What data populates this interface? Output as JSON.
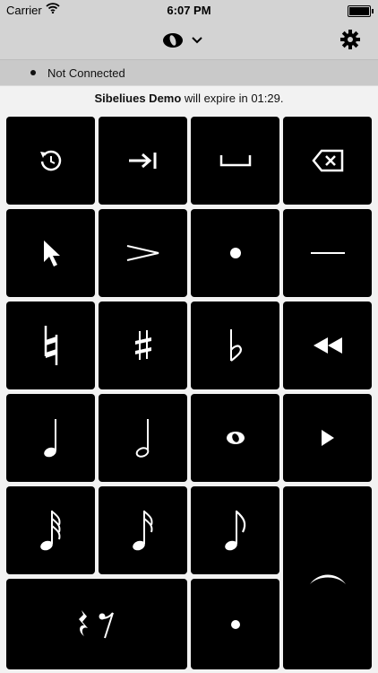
{
  "status_bar": {
    "carrier": "Carrier",
    "time": "6:07 PM"
  },
  "nav": {
    "logo_icon": "sibelius-logo-icon",
    "dropdown_icon": "chevron-down-icon",
    "settings_icon": "gear-icon"
  },
  "connection": {
    "status": "Not Connected"
  },
  "notice": {
    "app_name": "Sibeliues Demo",
    "message_prefix": " will expire in ",
    "countdown": "01:29",
    "message_suffix": "."
  },
  "keypad": {
    "keys": [
      {
        "icon": "undo-icon"
      },
      {
        "icon": "tab-next-icon"
      },
      {
        "icon": "space-icon"
      },
      {
        "icon": "backspace-icon"
      },
      {
        "icon": "pointer-icon"
      },
      {
        "icon": "accent-icon"
      },
      {
        "icon": "staccato-dot-icon"
      },
      {
        "icon": "tenuto-icon"
      },
      {
        "icon": "natural-icon"
      },
      {
        "icon": "sharp-icon"
      },
      {
        "icon": "flat-icon"
      },
      {
        "icon": "rewind-icon"
      },
      {
        "icon": "quarter-note-icon"
      },
      {
        "icon": "half-note-icon"
      },
      {
        "icon": "whole-note-icon"
      },
      {
        "icon": "play-icon"
      },
      {
        "icon": "thirty-second-note-icon"
      },
      {
        "icon": "sixteenth-note-icon"
      },
      {
        "icon": "eighth-note-icon"
      },
      {
        "icon": "tie-icon"
      },
      {
        "icon": "rest-icon"
      },
      {
        "icon": "dot-icon"
      }
    ]
  }
}
